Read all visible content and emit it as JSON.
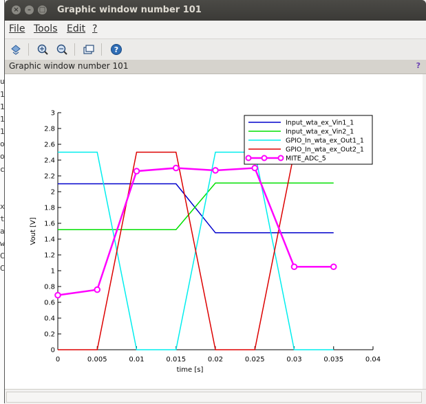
{
  "background_terminal": {
    "fragments": [
      "ut",
      "1.",
      "1.",
      "1.",
      "1.",
      "ol",
      "o.",
      "ca",
      "",
      "x",
      "til",
      "a",
      "w",
      "C",
      "C"
    ]
  },
  "window": {
    "title": "Graphic window number 101",
    "buttons": [
      "close-icon",
      "minimize-icon",
      "maximize-icon"
    ]
  },
  "menubar": {
    "items": [
      "File",
      "Tools",
      "Edit",
      "?"
    ]
  },
  "toolbar": {
    "icons": [
      "rotate-icon",
      "zoom-in-icon",
      "zoom-out-icon",
      "datatip-icon",
      "help-icon"
    ]
  },
  "figure": {
    "title": "Graphic window number 101",
    "help_label": "?"
  },
  "chart_data": {
    "type": "line",
    "xlabel": "time [s]",
    "ylabel": "Vout [V]",
    "xlim": [
      0,
      0.04
    ],
    "ylim": [
      0,
      3
    ],
    "x_ticks": [
      "0",
      "0.005",
      "0.01",
      "0.015",
      "0.02",
      "0.025",
      "0.03",
      "0.035",
      "0.04"
    ],
    "y_ticks": [
      "0",
      "0.2",
      "0.4",
      "0.6",
      "0.8",
      "1",
      "1.2",
      "1.4",
      "1.6",
      "1.8",
      "2",
      "2.2",
      "2.4",
      "2.6",
      "2.8",
      "3"
    ],
    "grid": false,
    "legend_position": "top-right",
    "series": [
      {
        "name": "Input_wta_ex_Vin1_1",
        "color": "#0000cc",
        "marker": false,
        "x": [
          0,
          0.015,
          0.02,
          0.035
        ],
        "y": [
          2.1,
          2.1,
          1.48,
          1.48
        ]
      },
      {
        "name": "Input_wta_ex_Vin2_1",
        "color": "#00e000",
        "marker": false,
        "x": [
          0,
          0.015,
          0.02,
          0.035
        ],
        "y": [
          1.52,
          1.52,
          2.11,
          2.11
        ]
      },
      {
        "name": "GPIO_In_wta_ex_Out1_1",
        "color": "#00eeee",
        "marker": false,
        "x": [
          0,
          0.005,
          0.01,
          0.015,
          0.02,
          0.025,
          0.03,
          0.035
        ],
        "y": [
          2.5,
          2.5,
          0,
          0,
          2.5,
          2.5,
          0,
          0
        ]
      },
      {
        "name": "GPIO_In_wta_ex_Out2_1",
        "color": "#dd0000",
        "marker": false,
        "x": [
          0,
          0.005,
          0.01,
          0.015,
          0.02,
          0.025,
          0.03
        ],
        "y": [
          0,
          0,
          2.5,
          2.5,
          0,
          0,
          2.5
        ]
      },
      {
        "name": "MITE_ADC_5",
        "color": "#ff00ff",
        "marker": true,
        "x": [
          0,
          0.005,
          0.01,
          0.015,
          0.02,
          0.025,
          0.03,
          0.035
        ],
        "y": [
          0.69,
          0.76,
          2.26,
          2.3,
          2.27,
          2.3,
          1.05,
          1.05
        ]
      }
    ]
  }
}
